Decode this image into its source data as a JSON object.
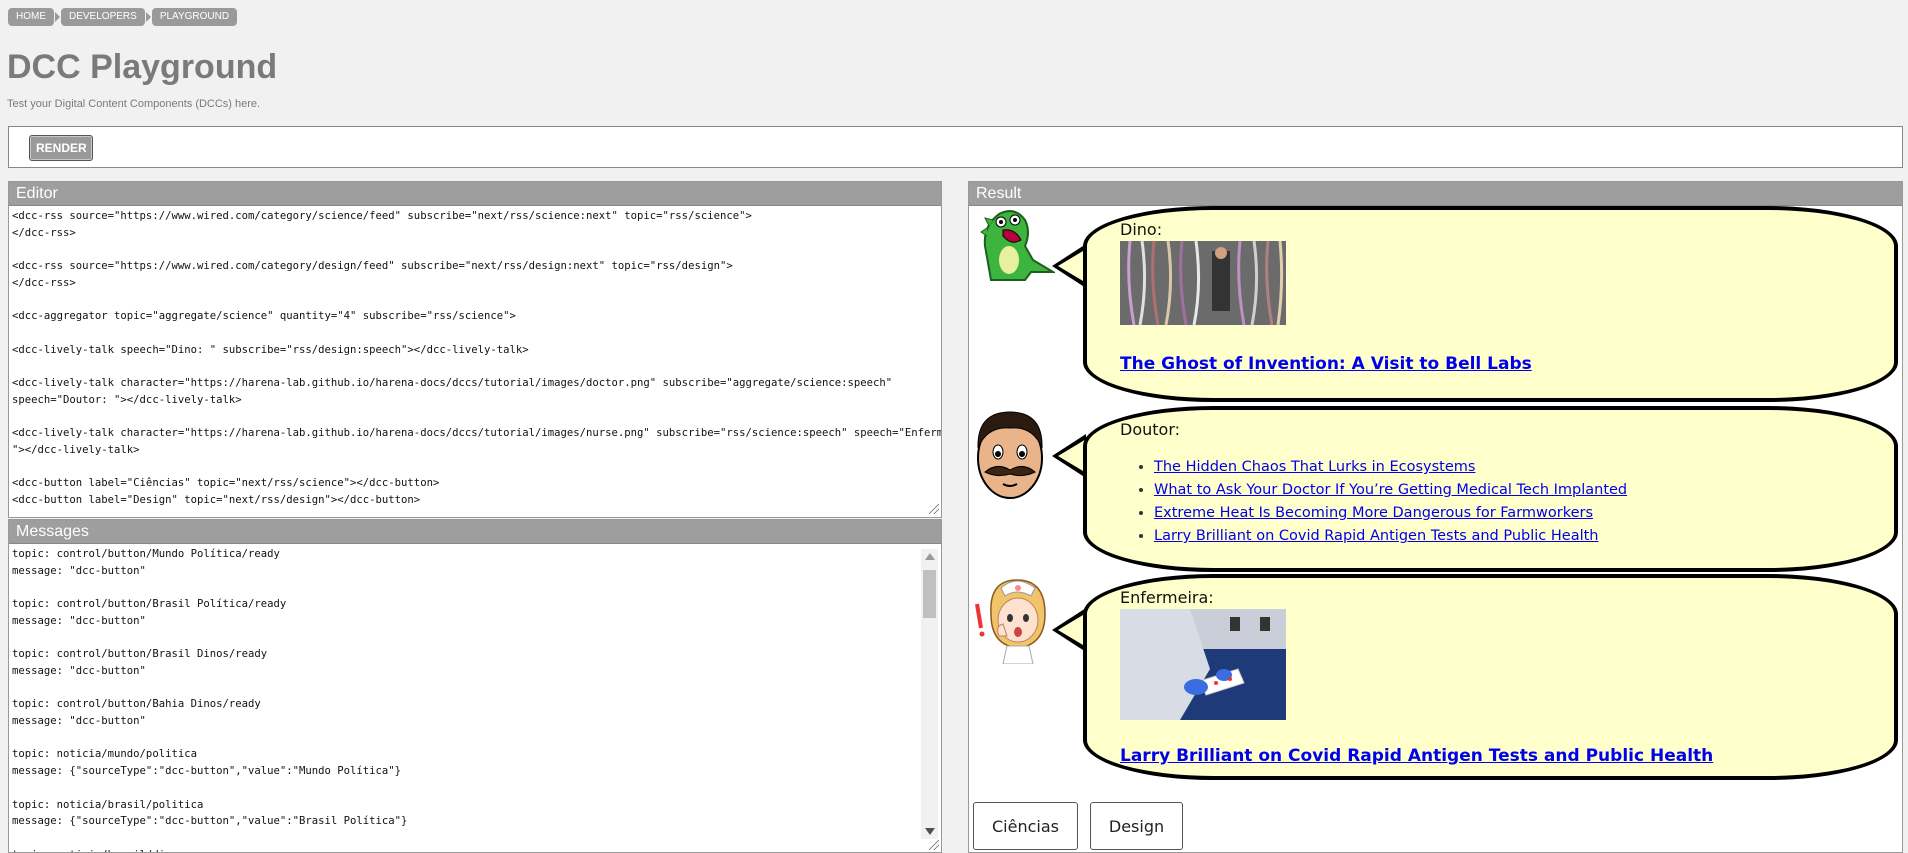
{
  "breadcrumb": [
    "HOME",
    "DEVELOPERS",
    "PLAYGROUND"
  ],
  "page": {
    "title": "DCC Playground",
    "subtitle": "Test your Digital Content Components (DCCs) here."
  },
  "toolbar": {
    "render_label": "RENDER"
  },
  "editor": {
    "title": "Editor",
    "code": "<dcc-rss source=\"https://www.wired.com/category/science/feed\" subscribe=\"next/rss/science:next\" topic=\"rss/science\">\n</dcc-rss>\n\n<dcc-rss source=\"https://www.wired.com/category/design/feed\" subscribe=\"next/rss/design:next\" topic=\"rss/design\">\n</dcc-rss>\n\n<dcc-aggregator topic=\"aggregate/science\" quantity=\"4\" subscribe=\"rss/science\">\n\n<dcc-lively-talk speech=\"Dino: \" subscribe=\"rss/design:speech\"></dcc-lively-talk>\n\n<dcc-lively-talk character=\"https://harena-lab.github.io/harena-docs/dccs/tutorial/images/doctor.png\" subscribe=\"aggregate/science:speech\"\nspeech=\"Doutor: \"></dcc-lively-talk>\n\n<dcc-lively-talk character=\"https://harena-lab.github.io/harena-docs/dccs/tutorial/images/nurse.png\" subscribe=\"rss/science:speech\" speech=\"Enfermeira:\n\"></dcc-lively-talk>\n\n<dcc-button label=\"Ciências\" topic=\"next/rss/science\"></dcc-button>\n<dcc-button label=\"Design\" topic=\"next/rss/design\"></dcc-button>"
  },
  "messages": {
    "title": "Messages",
    "log": "topic: control/button/Mundo Política/ready\nmessage: \"dcc-button\"\n\ntopic: control/button/Brasil Política/ready\nmessage: \"dcc-button\"\n\ntopic: control/button/Brasil Dinos/ready\nmessage: \"dcc-button\"\n\ntopic: control/button/Bahia Dinos/ready\nmessage: \"dcc-button\"\n\ntopic: noticia/mundo/politica\nmessage: {\"sourceType\":\"dcc-button\",\"value\":\"Mundo Política\"}\n\ntopic: noticia/brasil/politica\nmessage: {\"sourceType\":\"dcc-button\",\"value\":\"Brasil Política\"}\n\ntopic: noticia/brasil/dinos"
  },
  "result": {
    "title": "Result",
    "dino": {
      "speech_label": "Dino:",
      "headline": "The Ghost of Invention: A Visit to Bell Labs"
    },
    "doctor": {
      "speech_label": "Doutor:",
      "items": [
        "The Hidden Chaos That Lurks in Ecosystems",
        "What to Ask Your Doctor If You’re Getting Medical Tech Implanted",
        "Extreme Heat Is Becoming More Dangerous for Farmworkers",
        "Larry Brilliant on Covid Rapid Antigen Tests and Public Health"
      ]
    },
    "nurse": {
      "speech_label": "Enfermeira:",
      "headline": "Larry Brilliant on Covid Rapid Antigen Tests and Public Health"
    },
    "buttons": {
      "science": "Ciências",
      "design": "Design"
    }
  }
}
